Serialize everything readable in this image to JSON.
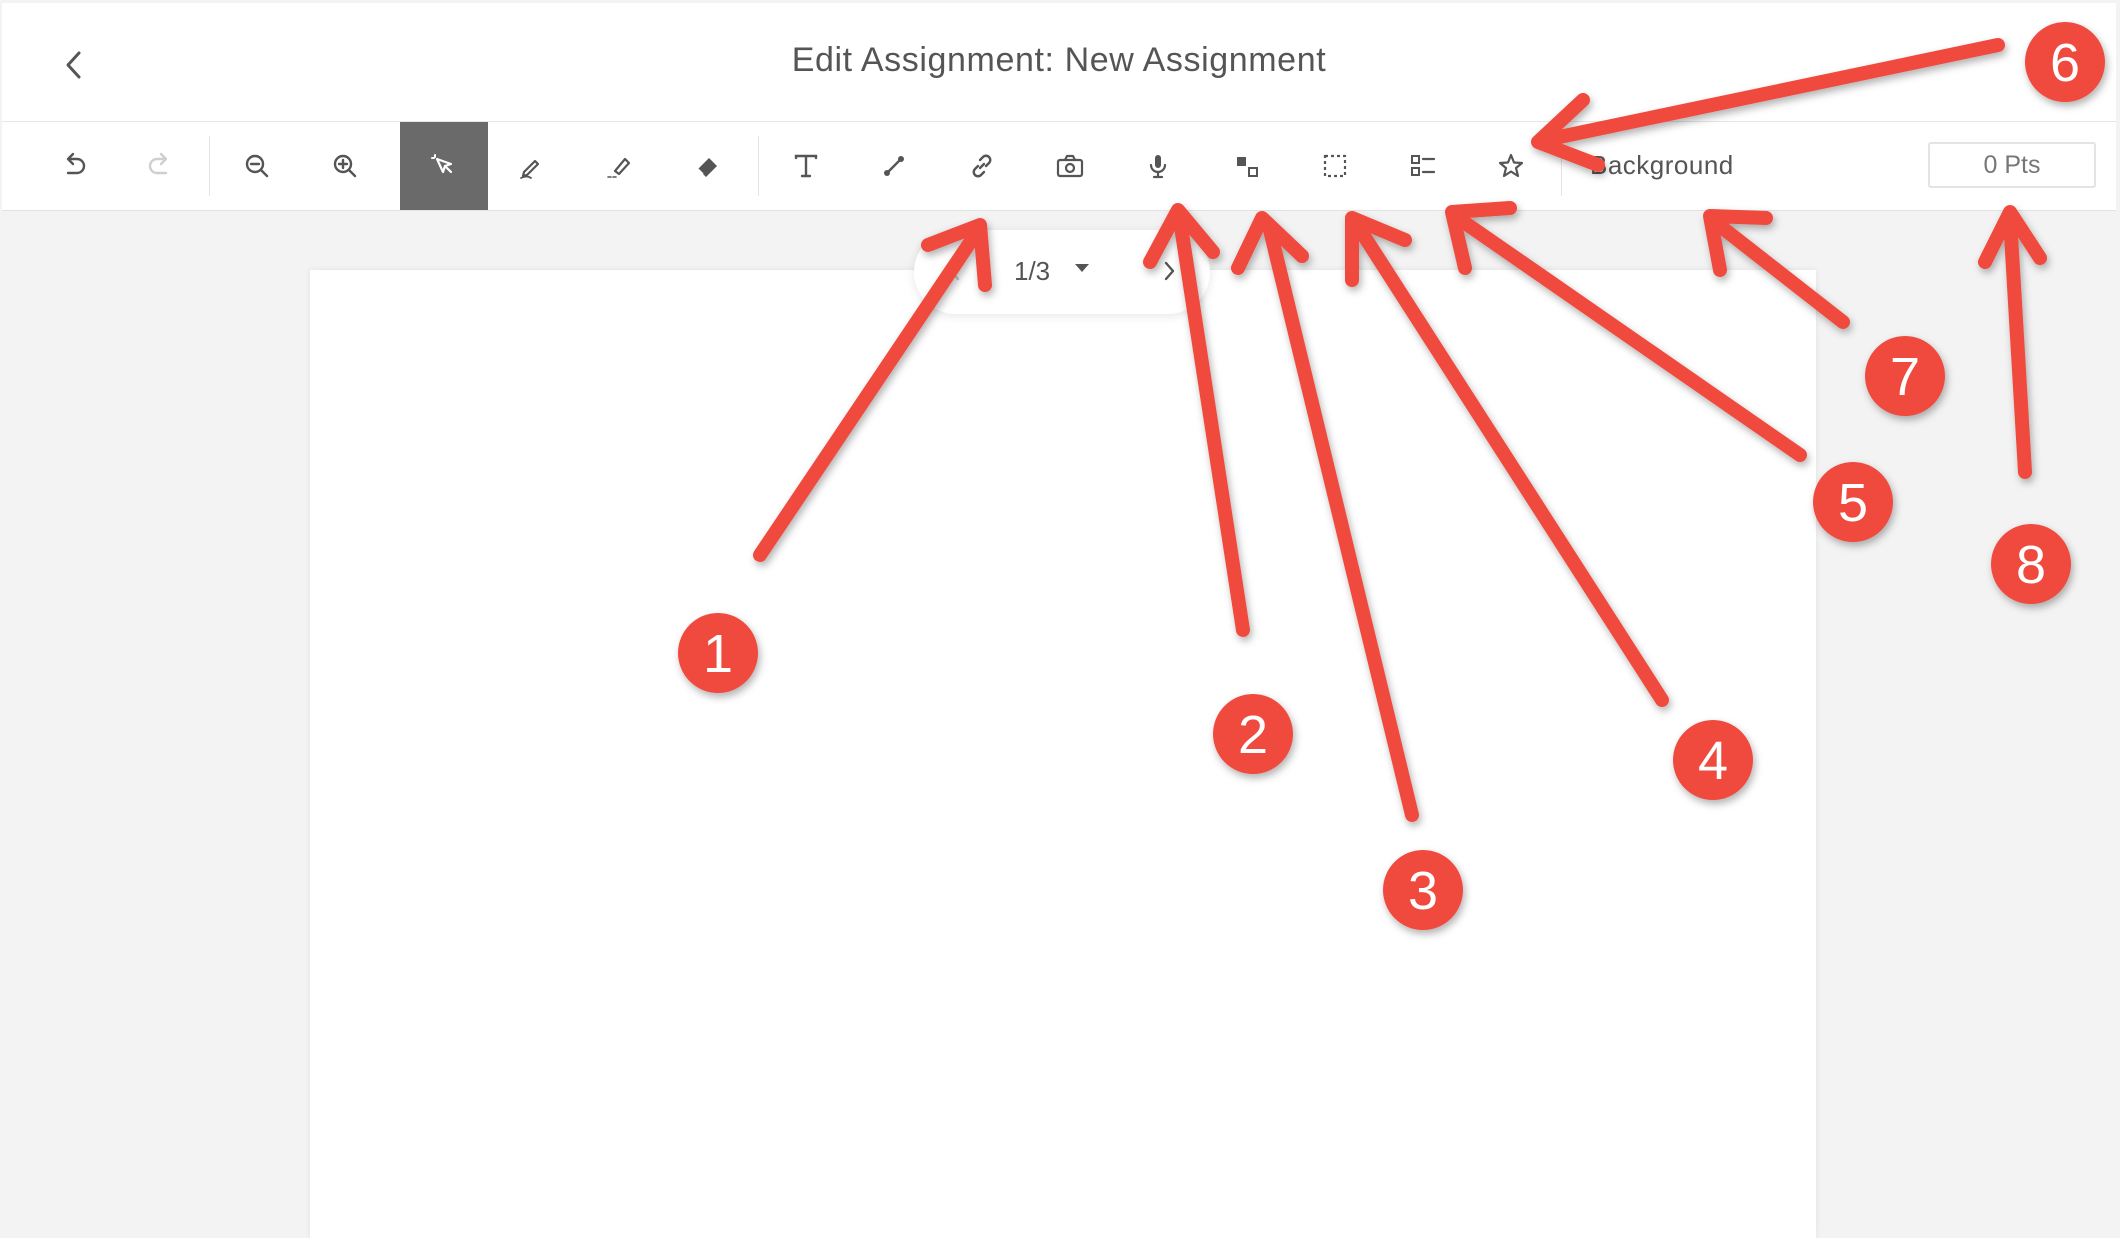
{
  "header": {
    "title": "Edit Assignment: New Assignment",
    "back_icon": "chevron-left-icon"
  },
  "toolbar": {
    "tools": [
      {
        "id": "undo",
        "icon": "undo-icon"
      },
      {
        "id": "redo",
        "icon": "redo-icon"
      },
      {
        "id": "zoom-out",
        "icon": "zoom-out-icon"
      },
      {
        "id": "zoom-in",
        "icon": "zoom-in-icon"
      },
      {
        "id": "select",
        "icon": "cursor-select-icon",
        "active": true
      },
      {
        "id": "pen",
        "icon": "pen-icon"
      },
      {
        "id": "highlighter",
        "icon": "highlighter-icon"
      },
      {
        "id": "eraser",
        "icon": "eraser-icon"
      },
      {
        "id": "text",
        "icon": "text-icon"
      },
      {
        "id": "line",
        "icon": "line-icon"
      },
      {
        "id": "link",
        "icon": "link-icon"
      },
      {
        "id": "camera",
        "icon": "camera-icon"
      },
      {
        "id": "microphone",
        "icon": "microphone-icon"
      },
      {
        "id": "match",
        "icon": "match-squares-icon"
      },
      {
        "id": "selection-box",
        "icon": "dashed-box-icon"
      },
      {
        "id": "checklist",
        "icon": "checklist-icon"
      },
      {
        "id": "star",
        "icon": "star-icon"
      }
    ],
    "background_label": "Background",
    "points_placeholder": "0 Pts"
  },
  "pager": {
    "text": "1/3",
    "prev_icon": "chevron-left-icon",
    "next_icon": "chevron-right-icon",
    "dropdown_icon": "caret-down-icon"
  },
  "callouts": {
    "color": "#f0483c",
    "markers": [
      "1",
      "2",
      "3",
      "4",
      "5",
      "6",
      "7",
      "8"
    ]
  },
  "colors": {
    "active_tool_bg": "#6a6a6a",
    "canvas_bg": "#f3f3f3",
    "text": "#555555"
  }
}
